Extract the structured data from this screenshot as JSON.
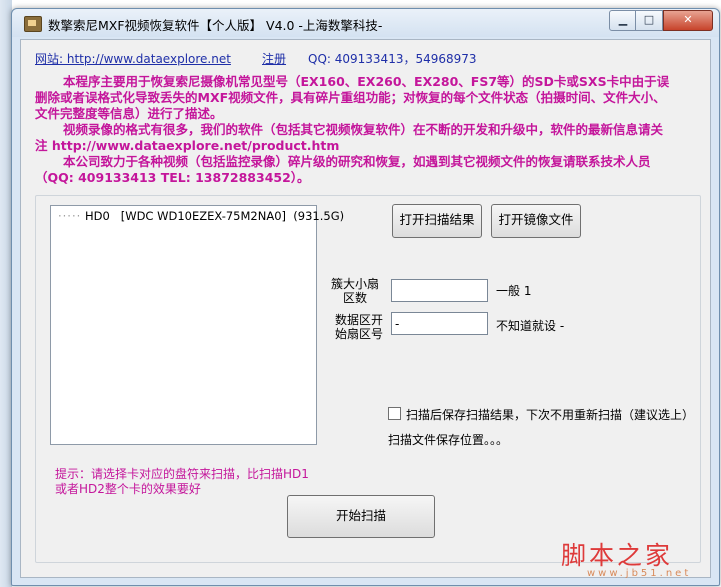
{
  "window": {
    "title": "数擎索尼MXF视频恢复软件【个人版】 V4.0 -上海数擎科技-",
    "minimize_glyph": "▁",
    "maximize_glyph": "□",
    "close_glyph": "✕",
    "icon": "app-icon"
  },
  "links": {
    "website_label": "网站: http://www.dataexplore.net",
    "register_label": "注册",
    "qq_text": "QQ: 409133413，54968973"
  },
  "description": {
    "para1": "本程序主要用于恢复索尼摄像机常见型号（EX160、EX260、EX280、FS7等）的SD卡或SXS卡中由于误删除或者误格式化导致丢失的MXF视频文件，具有碎片重组功能；对恢复的每个文件状态（拍摄时间、文件大小、文件完整度等信息）进行了描述。",
    "para2": "视频录像的格式有很多，我们的软件（包括其它视频恢复软件）在不断的开发和升级中，软件的最新信息请关注 http://www.dataexplore.net/product.htm",
    "para3": "本公司致力于各种视频（包括监控录像）碎片级的研究和恢复，如遇到其它视频文件的恢复请联系技术人员（QQ: 409133413 TEL: 13872883452）。",
    "color": "#c4169b"
  },
  "disk_tree": {
    "items": [
      {
        "label": "HD0   [WDC WD10EZEX-75M2NA0]  (931.5G)"
      }
    ]
  },
  "buttons": {
    "open_scan_result": "打开扫描结果",
    "open_image_file": "打开镜像文件",
    "start_scan": "开始扫描"
  },
  "fields": {
    "cluster_label": "簇大小扇区数",
    "cluster_value": "",
    "cluster_note": "一般 1",
    "start_sector_label": "数据区开始扇区号",
    "start_sector_value": "-",
    "start_sector_note": "不知道就设 -"
  },
  "save_option": {
    "checkbox_label": "扫描后保存扫描结果，下次不用重新扫描（建议选上）",
    "checked": false,
    "location_text": "扫描文件保存位置。。。"
  },
  "hint": {
    "text": "提示：请选择卡对应的盘符来扫描，比扫描HD1或者HD2整个卡的效果要好"
  },
  "watermark": {
    "main": "脚本之家",
    "sub": "www.jb51.net"
  }
}
